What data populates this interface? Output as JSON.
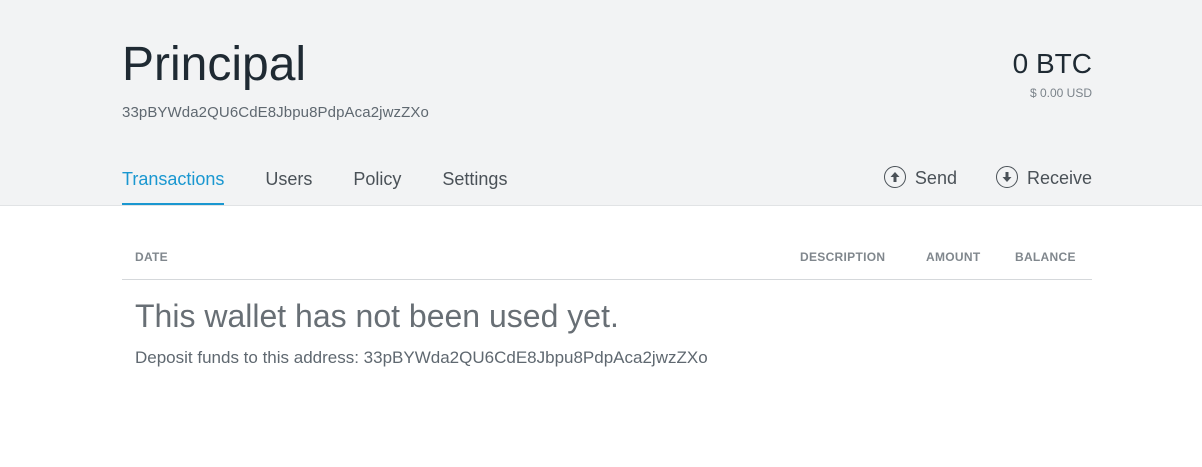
{
  "wallet": {
    "name": "Principal",
    "address": "33pBYWda2QU6CdE8Jbpu8PdpAca2jwzZXo",
    "balance_btc": "0 BTC",
    "balance_usd": "$ 0.00 USD"
  },
  "tabs": [
    {
      "label": "Transactions",
      "active": true
    },
    {
      "label": "Users",
      "active": false
    },
    {
      "label": "Policy",
      "active": false
    },
    {
      "label": "Settings",
      "active": false
    }
  ],
  "actions": {
    "send": {
      "label": "Send",
      "icon": "arrow-up-circle-icon"
    },
    "receive": {
      "label": "Receive",
      "icon": "arrow-down-circle-icon"
    }
  },
  "table": {
    "columns": [
      "DATE",
      "DESCRIPTION",
      "AMOUNT",
      "BALANCE"
    ]
  },
  "empty_state": {
    "title": "This wallet has not been used yet.",
    "message": "Deposit funds to this address: 33pBYWda2QU6CdE8Jbpu8PdpAca2jwzZXo"
  },
  "colors": {
    "accent": "#1a97d0",
    "header_bg": "#f2f3f4"
  }
}
